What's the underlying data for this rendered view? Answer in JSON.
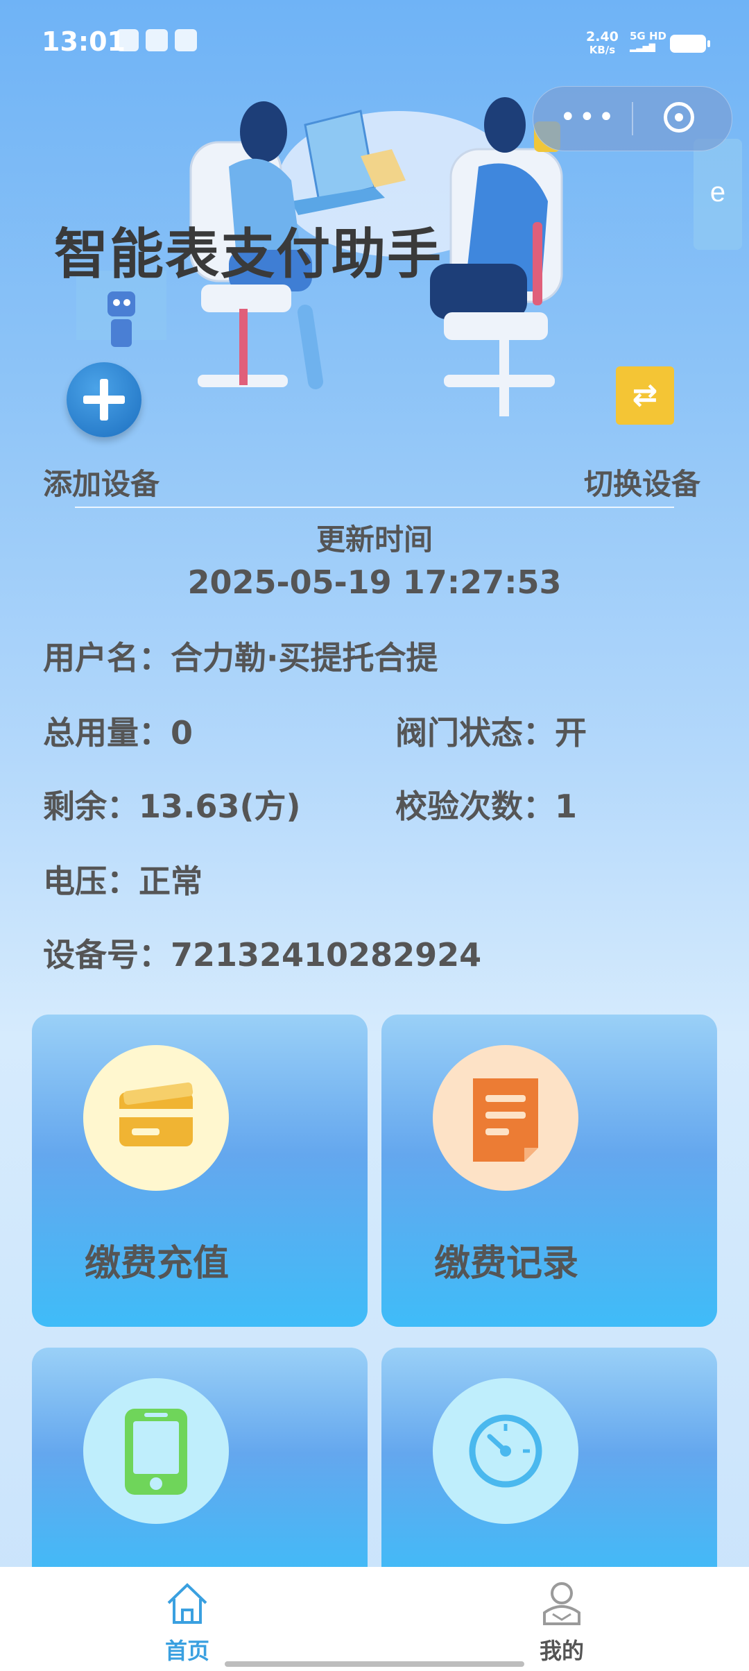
{
  "status_bar": {
    "time": "13:01",
    "net_speed_value": "2.40",
    "net_speed_unit": "KB/s",
    "signal_text": "5G HD"
  },
  "capsule": {
    "more_icon": "more-dots-icon",
    "close_icon": "target-circle-icon"
  },
  "header": {
    "app_title": "智能表支付助手",
    "add_device_label": "添加设备",
    "switch_device_label": "切换设备",
    "switch_icon": "⇄"
  },
  "update": {
    "label": "更新时间",
    "time": "2025-05-19 17:27:53"
  },
  "info": {
    "username": "用户名：合力勒·买提托合提",
    "total_usage": "总用量：0",
    "valve_status": "阀门状态：开",
    "remaining": "剩余：13.63(方)",
    "check_count": "校验次数：1",
    "voltage": "电压：正常",
    "device_no": "设备号：72132410282924"
  },
  "cards": [
    {
      "label": "缴费充值",
      "icon": "wallet-card-icon",
      "circle_color": "#fff7cf",
      "icon_color": "#f0b433"
    },
    {
      "label": "缴费记录",
      "icon": "record-document-icon",
      "circle_color": "#fde2c6",
      "icon_color": "#ec7c34"
    },
    {
      "label": "",
      "icon": "phone-icon",
      "circle_color": "#bfeefc",
      "icon_color": "#6fd55a"
    },
    {
      "label": "",
      "icon": "gauge-icon",
      "circle_color": "#bfeefc",
      "icon_color": "#4ab8ee"
    }
  ],
  "tabbar": {
    "home_label": "首页",
    "mine_label": "我的",
    "active_color": "#3aa0e0",
    "inactive_color": "#555555"
  }
}
